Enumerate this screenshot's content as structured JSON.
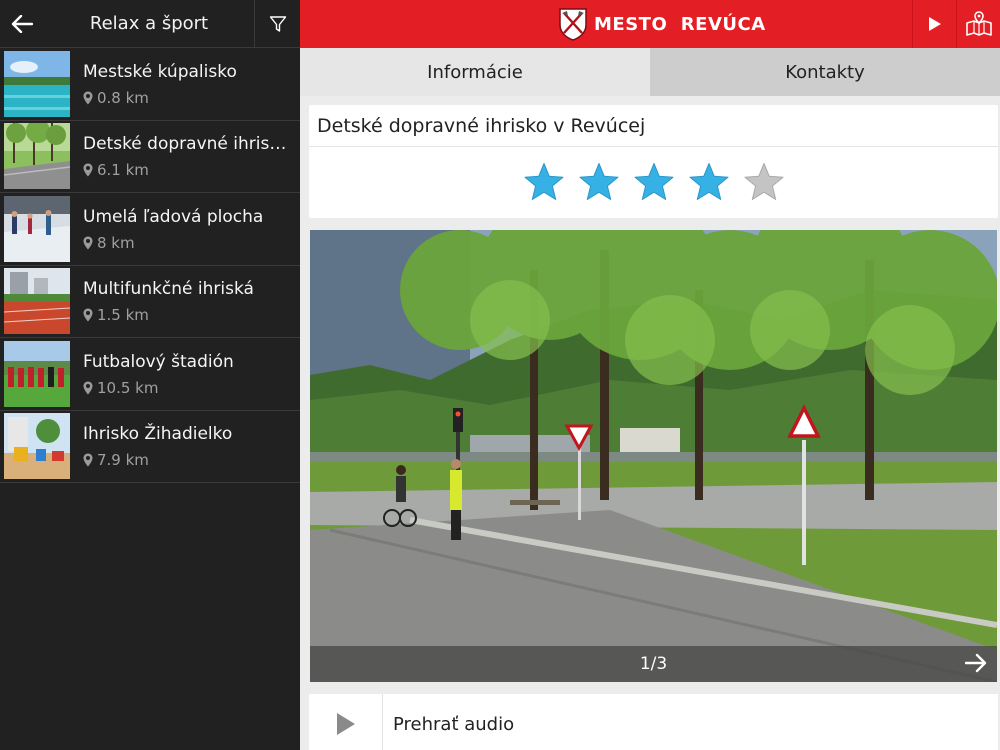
{
  "sidebar": {
    "title": "Relax a šport",
    "items": [
      {
        "name": "Mestské kúpalisko",
        "distance": "0.8 km",
        "thumb": "pool"
      },
      {
        "name": "Detské dopravné ihrisko v Revúcej",
        "distance": "6.1 km",
        "thumb": "traffic-park"
      },
      {
        "name": "Umelá ľadová plocha",
        "distance": "8 km",
        "thumb": "ice-rink"
      },
      {
        "name": "Multifunkčné ihriská",
        "distance": "1.5 km",
        "thumb": "track"
      },
      {
        "name": "Futbalový štadión",
        "distance": "10.5 km",
        "thumb": "football"
      },
      {
        "name": "Ihrisko Žihadielko",
        "distance": "7.9 km",
        "thumb": "playground"
      }
    ]
  },
  "header": {
    "brand": "MESTO  REVÚCA"
  },
  "tabs": [
    {
      "label": "Informácie",
      "active": true
    },
    {
      "label": "Kontakty",
      "active": false
    }
  ],
  "detail": {
    "title": "Detské dopravné ihrisko v Revúcej",
    "rating": 4,
    "rating_max": 5,
    "gallery_counter": "1/3"
  },
  "audio": {
    "label": "Prehrať audio"
  },
  "colors": {
    "brand_red": "#e31e24",
    "sidebar_bg": "#212121",
    "star_active": "#36b1e6",
    "star_inactive": "#c4c4c4"
  }
}
